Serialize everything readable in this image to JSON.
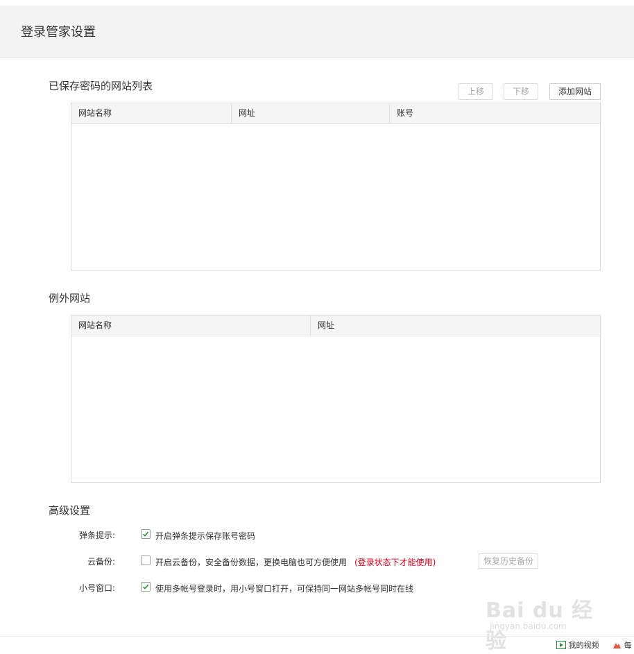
{
  "header": {
    "title": "登录管家设置"
  },
  "saved_sites": {
    "title": "已保存密码的网站列表",
    "buttons": {
      "move_up": "上移",
      "move_down": "下移",
      "add_site": "添加网站"
    },
    "columns": [
      "网站名称",
      "网址",
      "账号"
    ],
    "rows": []
  },
  "exception_sites": {
    "title": "例外网站",
    "columns": [
      "网站名称",
      "网址"
    ],
    "rows": []
  },
  "advanced": {
    "title": "高级设置",
    "popup": {
      "label": "弹条提示:",
      "checked": true,
      "text": "开启弹条提示保存账号密码"
    },
    "cloud_backup": {
      "label": "云备份:",
      "checked": false,
      "text": "开启云备份，安全备份数据，更换电脑也可方便使用",
      "warning": "(登录状态下才能使用)",
      "restore_button": "恢复历史备份"
    },
    "small_window": {
      "label": "小号窗口:",
      "checked": true,
      "text": "使用多帐号登录时，用小号窗口打开，可保持同一网站多帐号同时在线"
    }
  },
  "footer": {
    "my_videos": "我的视频",
    "partial": "每"
  },
  "watermark": {
    "logo": "Bai du 经验",
    "url": "jingyan.baidu.com"
  },
  "colors": {
    "check": "#2e8b3d",
    "warning": "#d9001b",
    "header_bg": "#f4f4f4"
  },
  "icons": {
    "checkbox_checked": "check-icon",
    "play": "play-icon",
    "fire": "fire-icon"
  }
}
